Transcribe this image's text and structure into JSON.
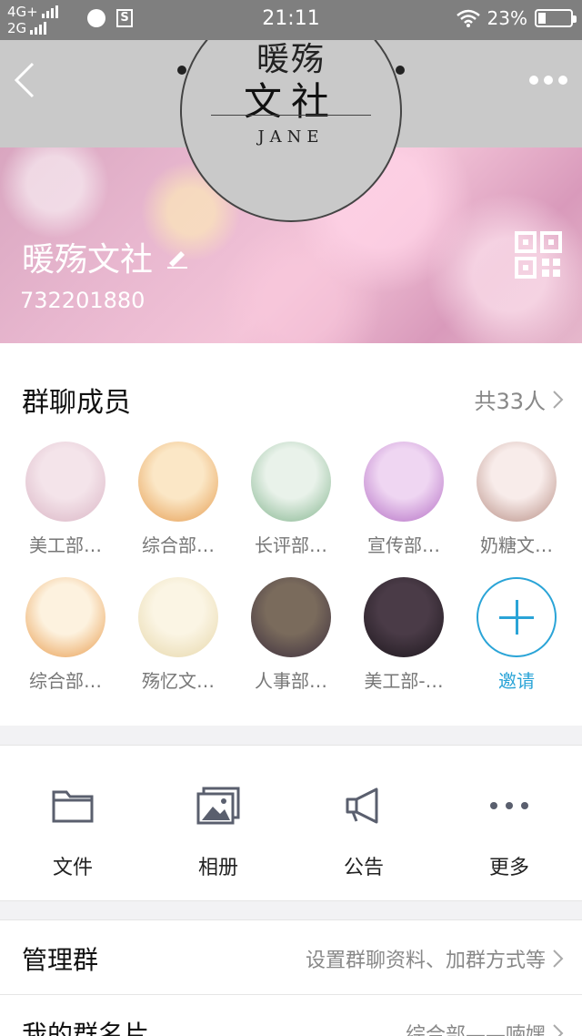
{
  "status_bar": {
    "network_top": "4G+",
    "network_bottom": "2G",
    "time": "21:11",
    "battery": "23%",
    "battery_level": 0.23
  },
  "header": {
    "logo_title": "暖殇",
    "logo_main": "文社",
    "logo_sub": "JANE",
    "group_name": "暖殇文社",
    "group_id": "732201880"
  },
  "members": {
    "title": "群聊成员",
    "count": "共33人",
    "list": [
      {
        "name": "美工部…",
        "colors": [
          "#f4e4ea",
          "#d9b3c3"
        ]
      },
      {
        "name": "综合部…",
        "colors": [
          "#fbe7c6",
          "#e59a4c"
        ]
      },
      {
        "name": "长评部…",
        "colors": [
          "#e9f2ea",
          "#7fb28a"
        ]
      },
      {
        "name": "宣传部…",
        "colors": [
          "#efd6f2",
          "#b26ac3"
        ]
      },
      {
        "name": "奶糖文…",
        "colors": [
          "#f8ecea",
          "#b58a80"
        ]
      },
      {
        "name": "综合部…",
        "colors": [
          "#fdf2df",
          "#e89a4a"
        ]
      },
      {
        "name": "殇忆文…",
        "colors": [
          "#fbf5e4",
          "#e6d6a8"
        ]
      },
      {
        "name": "人事部…",
        "colors": [
          "#7a6b5c",
          "#3b2d3d"
        ]
      },
      {
        "name": "美工部-…",
        "colors": [
          "#4a3b47",
          "#1c161c"
        ]
      }
    ],
    "invite_label": "邀请"
  },
  "tools": [
    {
      "label": "文件",
      "icon": "folder-icon"
    },
    {
      "label": "相册",
      "icon": "album-icon"
    },
    {
      "label": "公告",
      "icon": "megaphone-icon"
    },
    {
      "label": "更多",
      "icon": "more-icon"
    }
  ],
  "rows": [
    {
      "label": "管理群",
      "value": "设置群聊资料、加群方式等"
    },
    {
      "label": "我的群名片",
      "value": "综合部——喃嫼"
    }
  ],
  "colors": {
    "accent": "#2aa4d7",
    "status_bar": "#7f7f7f",
    "nav_bg": "#c9c9c9"
  }
}
